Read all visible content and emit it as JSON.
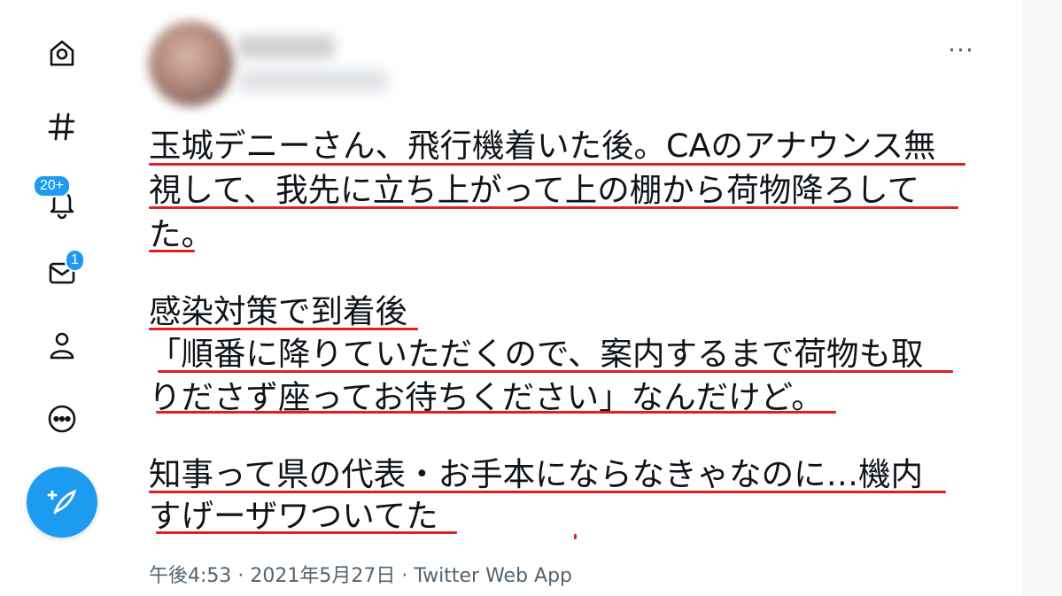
{
  "nav": {
    "items": [
      {
        "icon": "home-icon"
      },
      {
        "icon": "explore-hashtag-icon"
      },
      {
        "icon": "notifications-bell-icon",
        "badge": "20+"
      },
      {
        "icon": "messages-envelope-icon",
        "badge": "1"
      },
      {
        "icon": "profile-icon"
      },
      {
        "icon": "more-circle-icon"
      }
    ],
    "compose_icon": "compose-feather-icon"
  },
  "tweet": {
    "more_label": "···",
    "lines": [
      "玉城デニーさん、飛行機着いた後。CAのアナウンス無",
      "視して、我先に立ち上がって上の棚から荷物降ろして",
      "た。",
      "感染対策で到着後",
      "「順番に降りていただくので、案内するまで荷物も取",
      "りださず座ってお待ちください」なんだけど。",
      "知事って県の代表・お手本にならなきゃなのに…機内",
      "すげーザワついてた"
    ],
    "meta": "午後4:53 · 2021年5月27日 · Twitter Web App"
  },
  "colors": {
    "accent": "#1d9bf0",
    "underline": "#e02020",
    "text": "#0f1419",
    "muted": "#536471"
  }
}
